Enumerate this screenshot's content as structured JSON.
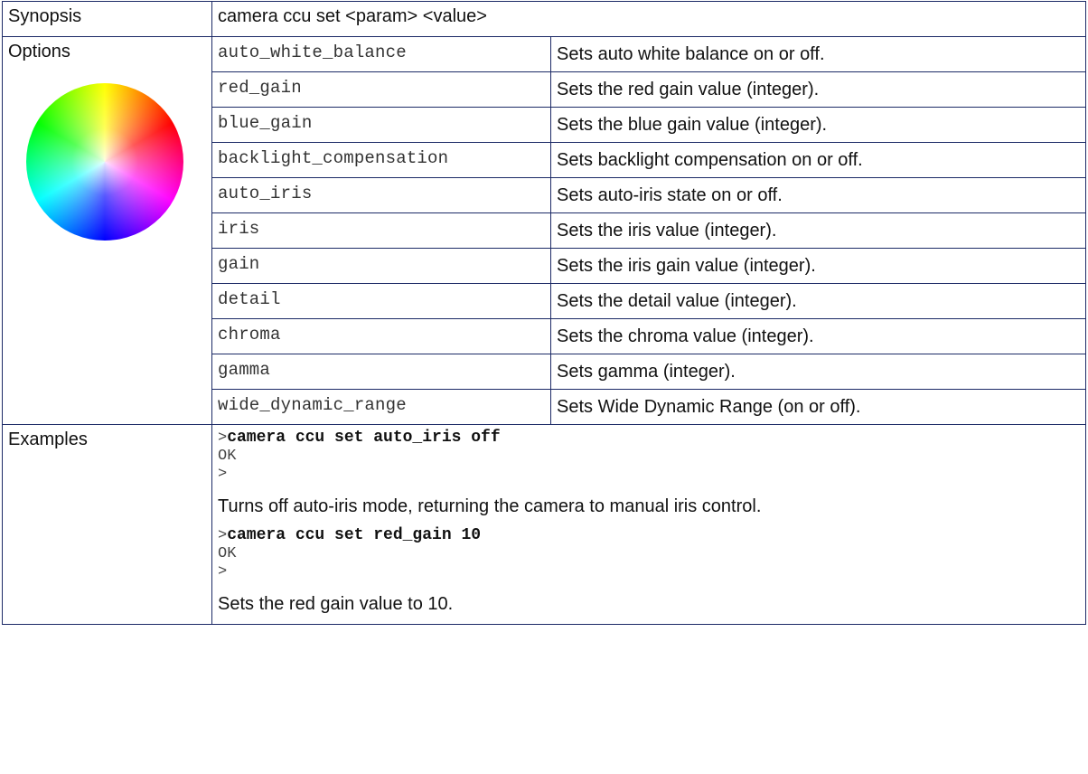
{
  "synopsis": {
    "label": "Synopsis",
    "text": "camera ccu set <param> <value>"
  },
  "options": {
    "label": "Options",
    "items": [
      {
        "name": "auto_white_balance",
        "desc": "Sets auto white balance on or off."
      },
      {
        "name": "red_gain",
        "desc": "Sets the red gain value (integer)."
      },
      {
        "name": "blue_gain",
        "desc": "Sets the blue gain value (integer)."
      },
      {
        "name": "backlight_compensation",
        "desc": "Sets backlight compensation on or off."
      },
      {
        "name": "auto_iris",
        "desc": "Sets auto-iris state on or off."
      },
      {
        "name": "iris",
        "desc": "Sets the iris value (integer)."
      },
      {
        "name": "gain",
        "desc": "Sets the iris gain value (integer)."
      },
      {
        "name": "detail",
        "desc": "Sets the detail value (integer)."
      },
      {
        "name": "chroma",
        "desc": "Sets the chroma value (integer)."
      },
      {
        "name": "gamma",
        "desc": "Sets gamma (integer)."
      },
      {
        "name": "wide_dynamic_range",
        "desc": "Sets Wide Dynamic Range (on or off)."
      }
    ]
  },
  "examples": {
    "label": "Examples",
    "items": [
      {
        "prompt": ">",
        "command": "camera ccu set auto_iris off",
        "response": "OK",
        "end_prompt": ">",
        "description": "Turns off auto-iris mode, returning the camera to manual iris control."
      },
      {
        "prompt": ">",
        "command": "camera ccu set red_gain 10",
        "response": "OK",
        "end_prompt": ">",
        "description": "Sets the red gain value to 10."
      }
    ]
  }
}
